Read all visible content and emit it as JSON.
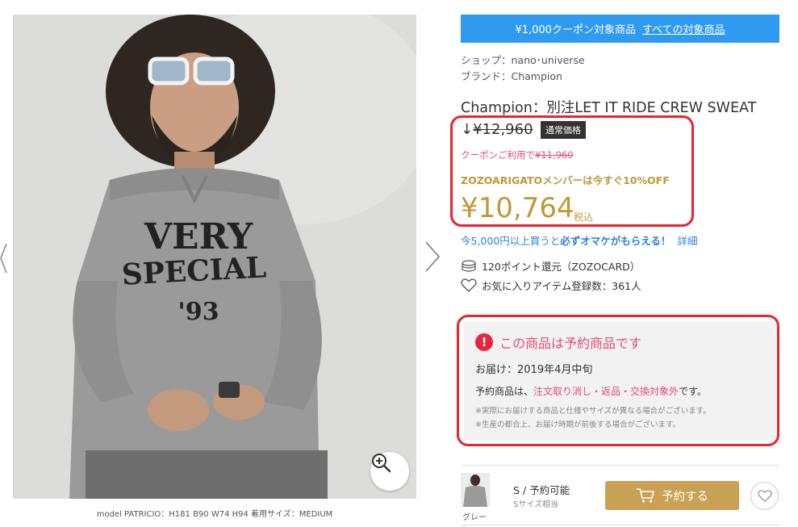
{
  "image": {
    "zoom_icon": "zoom-in-icon",
    "prev_icon": "chevron-left-icon",
    "next_icon": "chevron-right-icon",
    "shirt_print_line1": "VERY",
    "shirt_print_line2": "SPECIAL",
    "shirt_print_line3": "'93",
    "model_caption": "model PATRICIO：H181 B90 W74 H94 着用サイズ：MEDIUM"
  },
  "coupon_banner": {
    "text": "¥1,000クーポン対象商品",
    "link": "すべての対象商品",
    "color": "#2f9bf0"
  },
  "shop": {
    "label": "ショップ：nano･universe"
  },
  "brand": {
    "label": "ブランド：Champion"
  },
  "product": {
    "title": "Champion：別注LET IT RIDE CREW SWEAT"
  },
  "price": {
    "arrow": "↓",
    "regular": "¥12,960",
    "regular_badge": "通常価格",
    "coupon_prefix": "クーポンご利用で",
    "coupon_price": "¥11,960",
    "member_note": "ZOZOARIGATOメンバーは今すぐ10%OFF",
    "current": "¥10,764",
    "tax_label": "税込",
    "accent_color": "#bf9838"
  },
  "promo": {
    "prefix": "今5,000円以上買うと",
    "bold": "必ずオマケがもらえる！",
    "details_link": "詳細"
  },
  "points": {
    "icon": "coin-stack-icon",
    "text": "120ポイント還元（ZOZOCARD）"
  },
  "favorites": {
    "icon": "heart-outline-icon",
    "text": "お気に入りアイテム登録数：361人"
  },
  "preorder": {
    "icon": "exclamation-circle-icon",
    "title": "この商品は予約商品です",
    "delivery": "お届け：2019年4月中旬",
    "policy_prefix": "予約商品は、",
    "policy_highlight": "注文取り消し・返品・交換対象外",
    "policy_suffix": "です。",
    "note1": "※実際にお届けする商品と仕様やサイズが異なる場合がございます。",
    "note2": "※生産の都合上、お届け時期が前後する場合がございます。"
  },
  "variant": {
    "color_label": "グレー",
    "size": "S / 予約可能",
    "size_sub": "Sサイズ相当",
    "reserve_button": "予約する",
    "cart_icon": "cart-icon",
    "favorite_icon": "heart-outline-icon"
  }
}
